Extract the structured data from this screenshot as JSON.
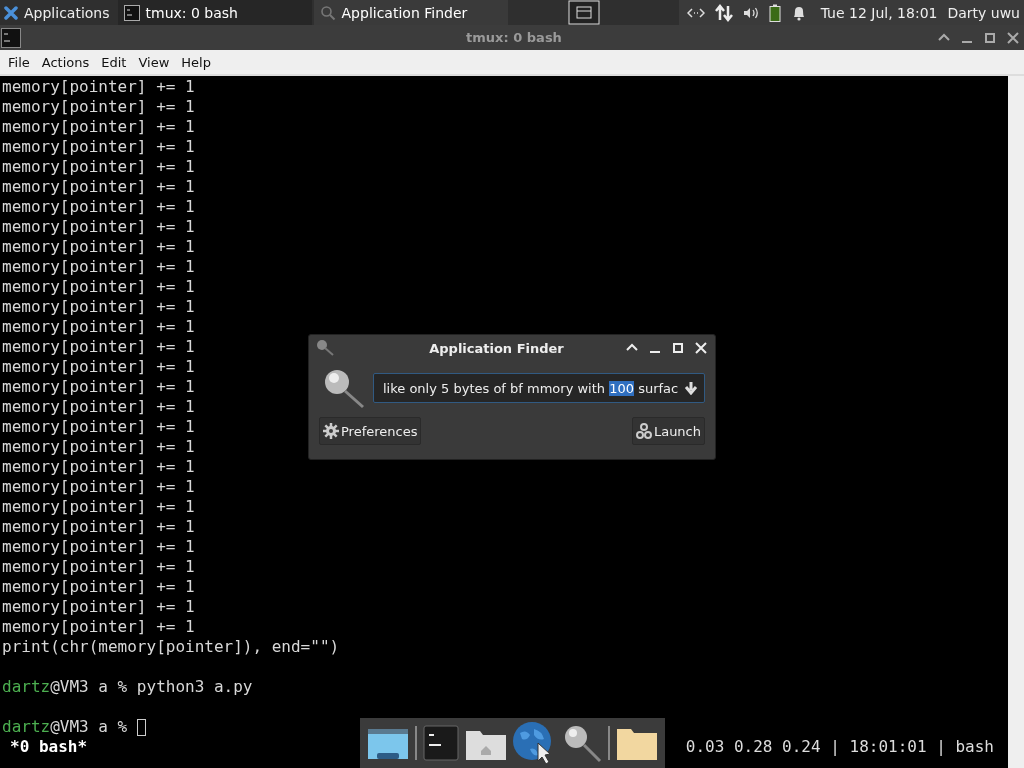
{
  "panel": {
    "menu_label": "Applications",
    "tasks": [
      {
        "label": "tmux: 0 bash",
        "kind": "terminal",
        "selected": false
      },
      {
        "label": "Application Finder",
        "kind": "search",
        "selected": true
      }
    ],
    "clock": "Tue 12 Jul, 18:01",
    "user": "Darty uwu"
  },
  "window": {
    "title": "tmux: 0 bash",
    "menu": [
      "File",
      "Actions",
      "Edit",
      "View",
      "Help"
    ]
  },
  "terminal": {
    "repeat_count_lines": [
      "memory[pointer] += 1",
      "memory[pointer] += 1",
      "memory[pointer] += 1",
      "memory[pointer] += 1",
      "memory[pointer] += 1",
      "memory[pointer] += 1",
      "memory[pointer] += 1",
      "memory[pointer] += 1",
      "memory[pointer] += 1",
      "memory[pointer] += 1",
      "memory[pointer] += 1",
      "memory[pointer] += 1",
      "memory[pointer] += 1",
      "memory[pointer] += 1",
      "memory[pointer] += 1",
      "memory[pointer] += 1",
      "memory[pointer] += 1",
      "memory[pointer] += 1",
      "memory[pointer] += 1",
      "memory[pointer] += 1",
      "memory[pointer] += 1",
      "memory[pointer] += 1",
      "memory[pointer] += 1",
      "memory[pointer] += 1",
      "memory[pointer] += 1",
      "memory[pointer] += 1",
      "memory[pointer] += 1",
      "memory[pointer] += 1",
      "print(chr(memory[pointer]), end=\"\")"
    ],
    "prompts": [
      {
        "user": "dartz",
        "rest": "@VM3 a % python3 a.py",
        "cursor": false
      },
      {
        "user": "dartz",
        "rest": "@VM3 a % ",
        "cursor": true
      }
    ],
    "status_left": "*0 bash*",
    "status_right": "0.03 0.28 0.24 | 18:01:01 | bash"
  },
  "dialog": {
    "title": "Application Finder",
    "query_before": "like only 5 bytes of bf mmory with ",
    "query_selected": "100",
    "query_after": " surfac",
    "buttons": [
      {
        "label": "Preferences",
        "kind": "gear"
      },
      {
        "label": "Launch",
        "kind": "gears"
      }
    ]
  },
  "dock": [
    {
      "kind": "desktop"
    },
    {
      "kind": "separator"
    },
    {
      "kind": "terminal"
    },
    {
      "kind": "home"
    },
    {
      "kind": "globe"
    },
    {
      "kind": "search"
    },
    {
      "kind": "separator"
    },
    {
      "kind": "folder"
    }
  ]
}
